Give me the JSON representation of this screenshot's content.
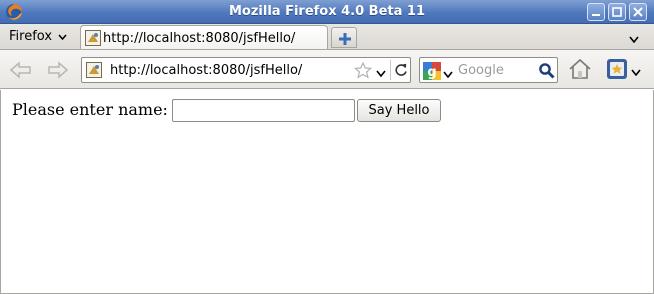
{
  "window": {
    "title": "Mozilla Firefox 4.0 Beta 11"
  },
  "tabstrip": {
    "menu_label": "Firefox",
    "tabs": [
      {
        "label": "http://localhost:8080/jsfHello/",
        "active": true
      }
    ]
  },
  "navbar": {
    "url": "http://localhost:8080/jsfHello/",
    "search_placeholder": "Google"
  },
  "page": {
    "prompt_label": "Please enter name:",
    "name_value": "",
    "submit_label": "Say Hello"
  },
  "icons": {
    "app": "firefox-icon",
    "favicon": "page-favicon",
    "search_engine": "google-icon"
  },
  "colors": {
    "titlebar": "#4f78bd",
    "title_text": "#ffffff",
    "accent": "#3b6cb8"
  }
}
